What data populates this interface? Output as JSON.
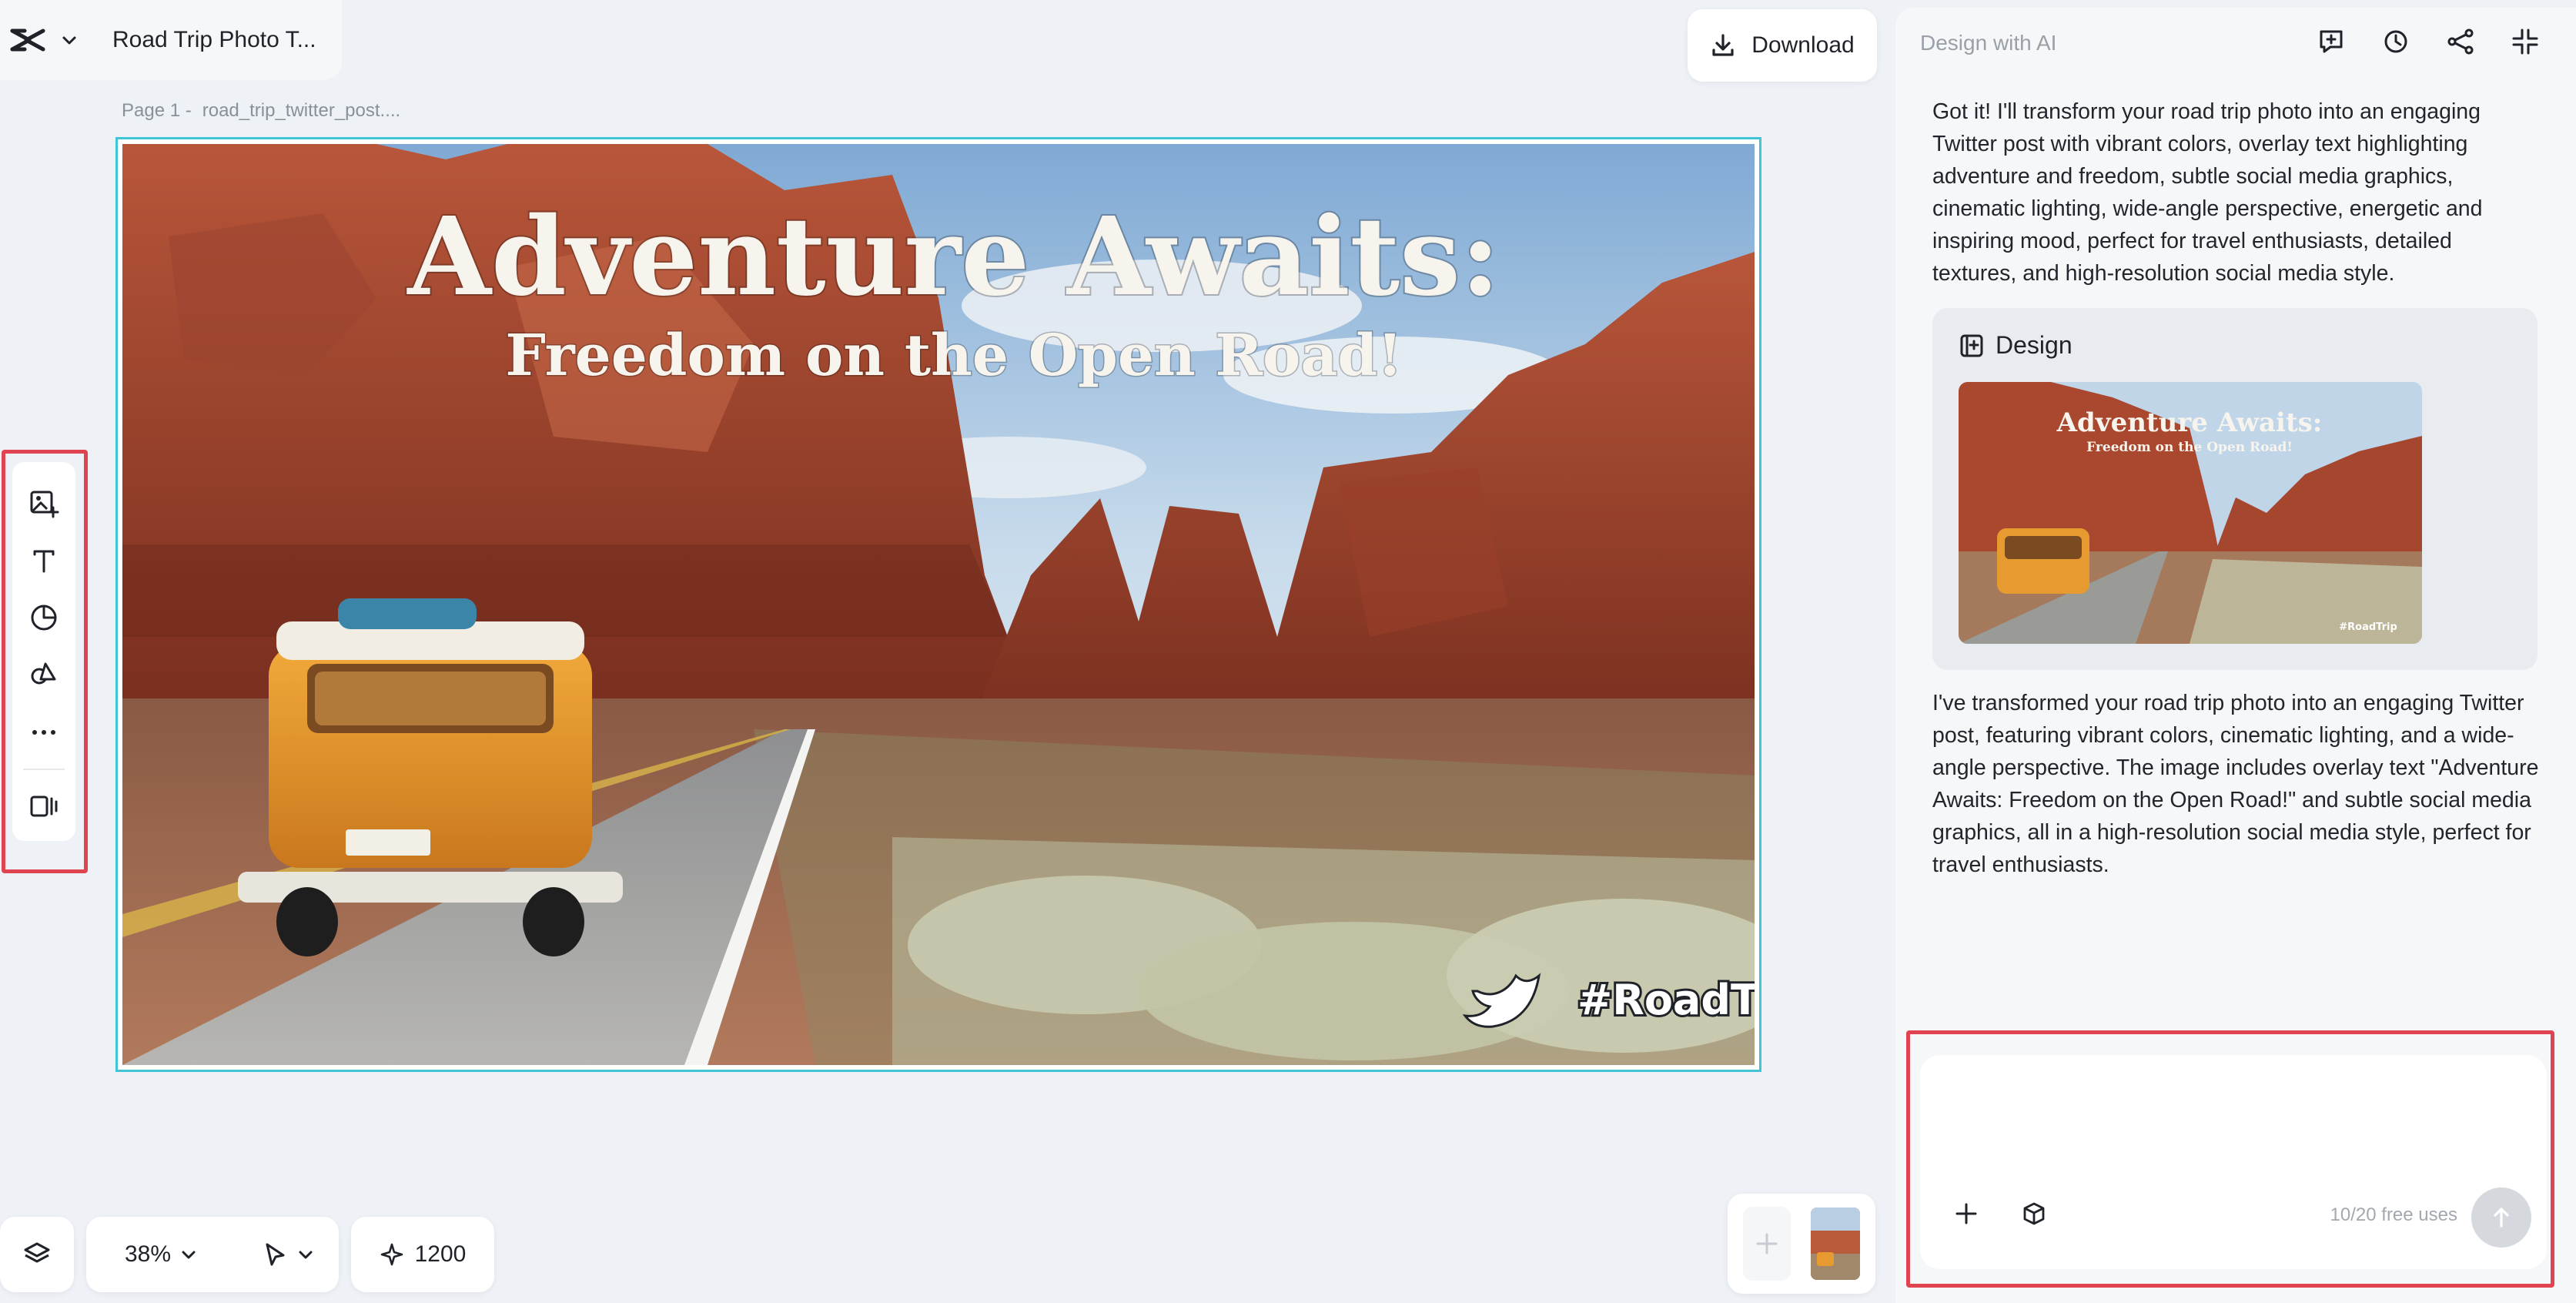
{
  "app": {
    "project_title": "Road Trip Photo T...",
    "download_label": "Download"
  },
  "canvas": {
    "page_label": "Page 1 -",
    "file_name": "road_trip_twitter_post....",
    "poster": {
      "headline": "Adventure Awaits:",
      "subheadline": "Freedom on the Open Road!",
      "hashtag": "#RoadTrip"
    }
  },
  "toolbar": {
    "items": [
      {
        "name": "add-image-icon"
      },
      {
        "name": "text-icon"
      },
      {
        "name": "sticker-icon"
      },
      {
        "name": "shapes-icon"
      },
      {
        "name": "more-icon"
      },
      {
        "name": "resize-icon"
      }
    ]
  },
  "bottom_bar": {
    "zoom": "38%",
    "credits": "1200"
  },
  "assistant": {
    "header_title": "Design with AI",
    "header_icons": [
      "new-chat-icon",
      "history-icon",
      "share-icon",
      "collapse-icon"
    ],
    "message_1": "Got it! I'll transform your road trip photo into an engaging Twitter post with vibrant colors, overlay text highlighting adventure and freedom, subtle social media graphics, cinematic lighting, wide-angle perspective, energetic and inspiring mood, perfect for travel enthusiasts, detailed textures, and high-resolution social media style.",
    "design_card_title": "Design",
    "design_thumb": {
      "headline": "Adventure Awaits:",
      "subheadline": "Freedom on the Open Road!",
      "hashtag": "#RoadTrip"
    },
    "message_2": "I've transformed your road trip photo into an engaging Twitter post, featuring vibrant colors, cinematic lighting, and a wide-angle perspective. The image includes overlay text \"Adventure Awaits: Freedom on the Open Road!\" and subtle social media graphics, all in a high-resolution social media style, perfect for travel enthusiasts.",
    "input_placeholder": "",
    "free_uses": "10/20 free uses"
  },
  "colors": {
    "selection_border": "#40c4d6",
    "highlight_red": "#e14451",
    "background": "#eef1f5"
  }
}
